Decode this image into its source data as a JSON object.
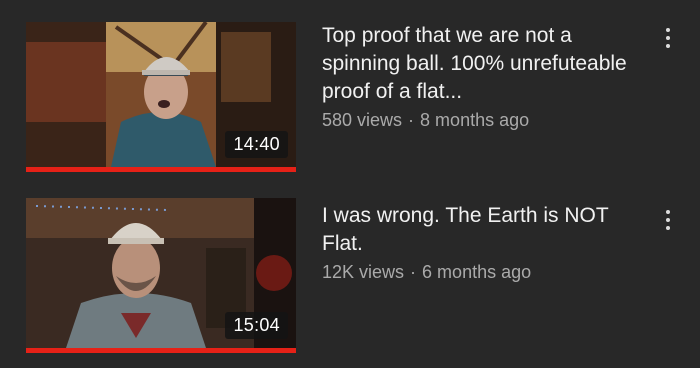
{
  "videos": [
    {
      "title": "Top proof that we are not a spinning ball. 100% unrefuteable proof of a flat...",
      "views": "580 views",
      "separator": "·",
      "age": "8 months ago",
      "duration": "14:40",
      "watch_progress": 1.0
    },
    {
      "title": "I was wrong. The Earth is NOT Flat.",
      "views": "12K views",
      "separator": "·",
      "age": "6 months ago",
      "duration": "15:04",
      "watch_progress": 1.0
    }
  ],
  "colors": {
    "background": "#282828",
    "progress": "#e62117",
    "title": "#f1f1f1",
    "meta": "#aaaaaa"
  },
  "icons": {
    "more": "more-vert-icon"
  }
}
